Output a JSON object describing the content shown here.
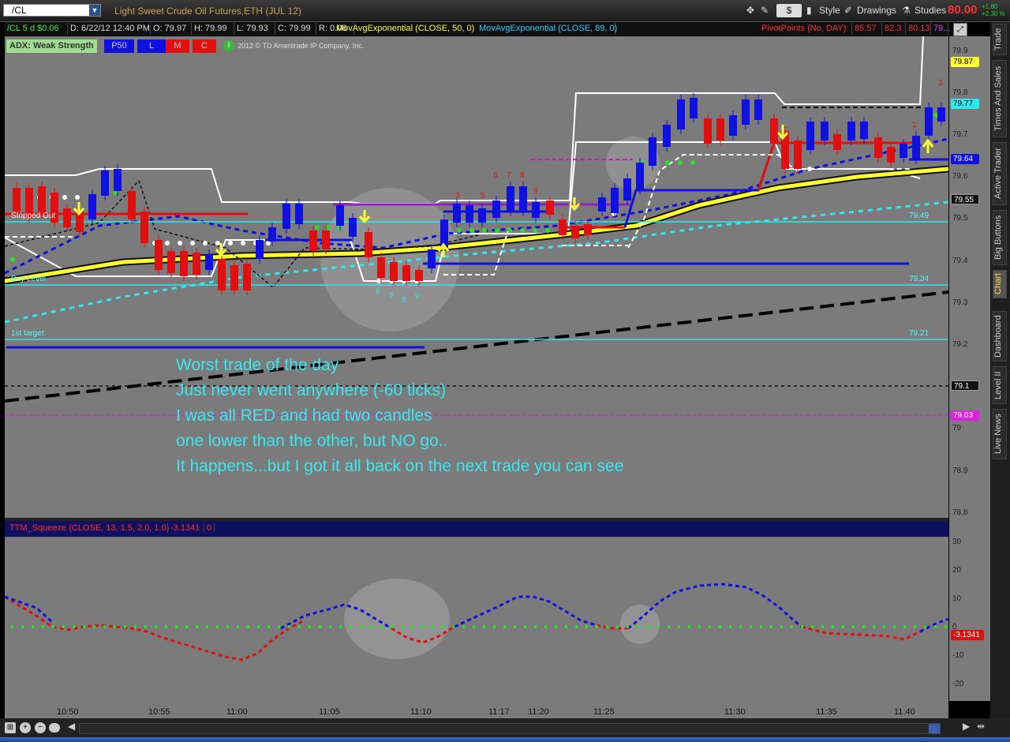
{
  "toolbar": {
    "symbol": "/CL",
    "description": "Light Sweet Crude Oil Futures,ETH (JUL 12)",
    "dollar_label": "$",
    "style_label": "Style",
    "drawings_label": "Drawings",
    "studies_label": "Studies",
    "last_price": "80.00",
    "change_abs": "+1.80",
    "change_pct": "+2.30 %"
  },
  "infobar": {
    "symbol_period": "/CL 5 d $0.06",
    "date": "D: 6/22/12 12:40 PM",
    "open": "O: 79.97",
    "high": "H: 79.99",
    "low": "L: 79.93",
    "close": "C: 79.99",
    "range": "R: 0.06",
    "ema50": "MovAvgExponential (CLOSE, 50, 0)",
    "ema89": "MovAvgExponential (CLOSE, 89, 0)",
    "pivot_label": "PivotPoints (No, DAY)",
    "pivot_r1": "85.57",
    "pivot_pp": "82.3",
    "pivot_s1": "80.13",
    "pivot_more": "79..."
  },
  "studies_row": {
    "adx": "ADX: Weak Strength",
    "p50": "P50",
    "l": "L",
    "m": "M",
    "c": "C",
    "copyright": "2012 © TD Ameritrade IP Company, Inc."
  },
  "levels": {
    "stopped_out": "Stopped Out",
    "buy_level": "Buy Level",
    "first_target": "1st target",
    "val_7949": "79.49",
    "val_7934": "79.34",
    "val_7921": "79.21"
  },
  "annotation": {
    "line1": "Worst trade of the day",
    "line2": "Just never went anywhere (-60 ticks)",
    "line3": "I was all RED and had two candles",
    "line4": "one lower than the other, but NO go..",
    "line5": "It happens...but I got it all back on the next trade you can see"
  },
  "squeeze": {
    "label": "TTM_Squeeze (CLOSE, 13, 1.5, 2.0, 1.0)",
    "value": "-3.1341",
    "zero": "0",
    "tag": "-3.1341"
  },
  "price_axis": {
    "ticks": [
      "79.9",
      "79.8",
      "79.7",
      "79.6",
      "79.5",
      "79.4",
      "79.3",
      "79.2",
      "79",
      "78.9",
      "78.8"
    ],
    "tag_7987": "79.87",
    "tag_7977": "79.77",
    "tag_7964": "79.64",
    "tag_7955": "79.55",
    "tag_791": "79.1",
    "tag_7903": "79.03"
  },
  "lower_axis": {
    "ticks": [
      "30",
      "20",
      "10",
      "0",
      "-10",
      "-20"
    ]
  },
  "time_axis": [
    "10:50",
    "10:55",
    "11:00",
    "11:05",
    "11:10",
    "11:17",
    "11:20",
    "11:25",
    "11:30",
    "11:35",
    "11:40"
  ],
  "sidebar_tabs": [
    "Trade",
    "Times And Sales",
    "Active Trader",
    "Big Buttons",
    "Chart",
    "Dashboard",
    "Level II",
    "Live News"
  ],
  "candle_numbers": {
    "n6a": "6",
    "n7a": "7",
    "n8a": "8",
    "n9a": "9",
    "n3": "3",
    "n5": "5",
    "n6b": "6",
    "n7b": "7",
    "n8b": "8",
    "n9b": "9",
    "n1": "1",
    "n3b": "3"
  },
  "colors": {
    "chart_bg": "#7b7b7b",
    "bull": "#1010e0",
    "bear": "#e01010",
    "ema_yellow": "#ffff33",
    "cyan_line": "#30e8f0",
    "annotation": "#38e8f0"
  }
}
